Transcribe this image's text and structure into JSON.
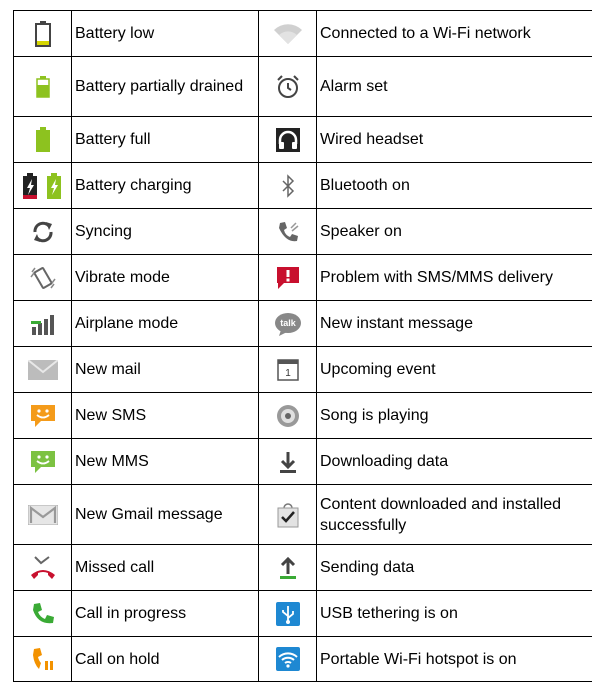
{
  "rows": [
    {
      "left": {
        "icon": "battery-low-icon",
        "label": "Battery low"
      },
      "right": {
        "icon": "wifi-connected-icon",
        "label": "Connected to a Wi-Fi network"
      }
    },
    {
      "left": {
        "icon": "battery-partially-drained-icon",
        "label": "Battery partially drained"
      },
      "right": {
        "icon": "alarm-icon",
        "label": "Alarm set"
      }
    },
    {
      "left": {
        "icon": "battery-full-icon",
        "label": "Battery full"
      },
      "right": {
        "icon": "wired-headset-icon",
        "label": "Wired headset"
      }
    },
    {
      "left": {
        "icon": "battery-charging-icon",
        "label": "Battery charging"
      },
      "right": {
        "icon": "bluetooth-icon",
        "label": "Bluetooth on"
      }
    },
    {
      "left": {
        "icon": "syncing-icon",
        "label": "Syncing"
      },
      "right": {
        "icon": "speaker-icon",
        "label": "Speaker on"
      }
    },
    {
      "left": {
        "icon": "vibrate-icon",
        "label": "Vibrate mode"
      },
      "right": {
        "icon": "sms-problem-icon",
        "label": "Problem with SMS/MMS delivery"
      }
    },
    {
      "left": {
        "icon": "airplane-mode-icon",
        "label": "Airplane mode"
      },
      "right": {
        "icon": "instant-message-icon",
        "label": "New instant message",
        "icon_text": "talk"
      }
    },
    {
      "left": {
        "icon": "mail-icon",
        "label": "New mail"
      },
      "right": {
        "icon": "calendar-icon",
        "label": "Upcoming event",
        "icon_text": "1"
      }
    },
    {
      "left": {
        "icon": "sms-icon",
        "label": "New SMS"
      },
      "right": {
        "icon": "song-playing-icon",
        "label": "Song is playing"
      }
    },
    {
      "left": {
        "icon": "mms-icon",
        "label": "New MMS"
      },
      "right": {
        "icon": "download-icon",
        "label": "Downloading data"
      }
    },
    {
      "left": {
        "icon": "gmail-icon",
        "label": "New Gmail message"
      },
      "right": {
        "icon": "installed-icon",
        "label": "Content downloaded and installed successfully"
      }
    },
    {
      "left": {
        "icon": "missed-call-icon",
        "label": "Missed call"
      },
      "right": {
        "icon": "upload-icon",
        "label": "Sending data"
      }
    },
    {
      "left": {
        "icon": "call-in-progress-icon",
        "label": "Call in progress"
      },
      "right": {
        "icon": "usb-tethering-icon",
        "label": "USB tethering is on"
      }
    },
    {
      "left": {
        "icon": "call-on-hold-icon",
        "label": "Call on hold"
      },
      "right": {
        "icon": "wifi-hotspot-icon",
        "label": "Portable Wi-Fi hotspot is on"
      }
    }
  ],
  "colors": {
    "battery_green": "#8dc21f",
    "battery_low_yellow": "#d6d600",
    "wifi_grey": "#c8c8c8",
    "icon_dark": "#444444",
    "sms_orange": "#f49b1a",
    "mms_green": "#7cc242",
    "alert_red": "#c8102e",
    "call_green": "#3aaa35",
    "call_orange": "#f39200",
    "hotspot_blue": "#1e88d2"
  }
}
